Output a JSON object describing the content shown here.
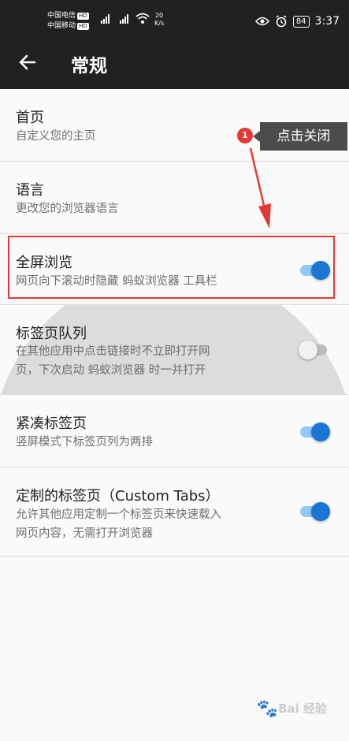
{
  "status_bar": {
    "carrier1": "中国电信",
    "carrier2": "中国移动",
    "hd": "HD",
    "net_speed": "20",
    "net_unit": "K/s",
    "battery": "84",
    "time": "3:37"
  },
  "header": {
    "title": "常规"
  },
  "settings": [
    {
      "title": "首页",
      "subtitle": "自定义您的主页"
    },
    {
      "title": "语言",
      "subtitle": "更改您的浏览器语言"
    },
    {
      "title": "全屏浏览",
      "subtitle": "网页向下滚动时隐藏 蚂蚁浏览器 工具栏",
      "toggle": true
    },
    {
      "title": "标签页队列",
      "subtitle_line1": "在其他应用中点击链接时不立即打开网",
      "subtitle_line2": "页，下次启动 蚂蚁浏览器 时一并打开",
      "toggle": false
    },
    {
      "title": "紧凑标签页",
      "subtitle": "竖屏模式下标签页列为两排",
      "toggle": true
    },
    {
      "title": "定制的标签页（Custom Tabs）",
      "subtitle_line1": "允许其他应用定制一个标签页来快速载入",
      "subtitle_line2": "网页内容，无需打开浏览器",
      "toggle": true
    }
  ],
  "annotation": {
    "badge": "1",
    "callout": "点击关闭",
    "color": "#e53935"
  },
  "watermark": "Bai 经验",
  "colors": {
    "header_bg": "#212121",
    "toggle_on": "#1976d2",
    "toggle_off": "#f1f1f1"
  }
}
